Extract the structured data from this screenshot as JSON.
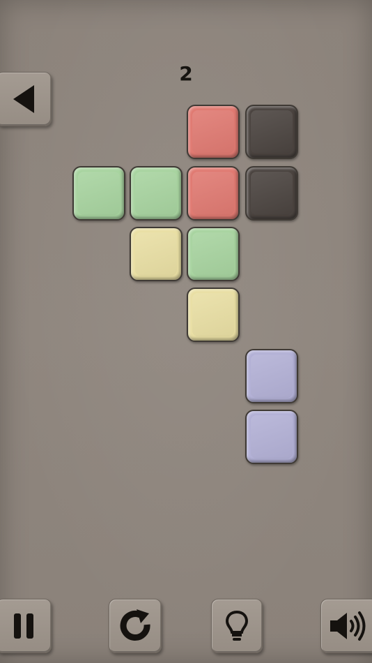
{
  "level": {
    "number": "2"
  },
  "colors": {
    "red": "#e07a72",
    "green": "#a8d4a0",
    "yellow": "#e9dfa4",
    "purple": "#b3b1d6",
    "dark": "#4b4440",
    "background": "#8e857d"
  },
  "board": {
    "tiles": [
      {
        "color": "red"
      },
      {
        "color": "dark"
      },
      {
        "color": "green"
      },
      {
        "color": "green"
      },
      {
        "color": "red"
      },
      {
        "color": "dark"
      },
      {
        "color": "yellow"
      },
      {
        "color": "green"
      },
      {
        "color": "yellow"
      },
      {
        "color": "purple"
      },
      {
        "color": "purple"
      }
    ]
  },
  "controls": {
    "back": {
      "icon": "triangle-left-icon"
    },
    "pause": {
      "icon": "pause-icon"
    },
    "restart": {
      "icon": "restart-icon"
    },
    "hint": {
      "icon": "lightbulb-icon"
    },
    "sound": {
      "icon": "speaker-icon"
    }
  }
}
